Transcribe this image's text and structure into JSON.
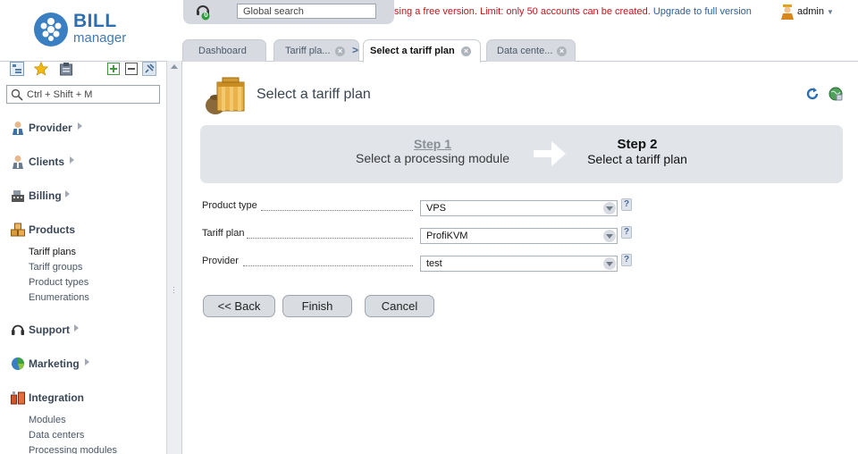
{
  "logo": {
    "word1": "BILL",
    "word2": "manager"
  },
  "topbar": {
    "notification_count": "0",
    "search_placeholder": "Global search"
  },
  "banner": {
    "warning": "sing a free version. Limit: only 50 accounts can be created.",
    "upgrade_link": "Upgrade to full version"
  },
  "user": {
    "name": "admin"
  },
  "tabs": [
    {
      "label": "Dashboard"
    },
    {
      "label": "Tariff pla..."
    },
    {
      "label": "Select a tariff plan"
    },
    {
      "label": "Data cente..."
    }
  ],
  "tab_separator": ">",
  "sidebar": {
    "search_placeholder": "Ctrl + Shift + M",
    "sections": [
      {
        "label": "Provider",
        "items": []
      },
      {
        "label": "Clients",
        "items": []
      },
      {
        "label": "Billing",
        "items": []
      },
      {
        "label": "Products",
        "items": [
          "Tariff plans",
          "Tariff groups",
          "Product types",
          "Enumerations"
        ]
      },
      {
        "label": "Support",
        "items": []
      },
      {
        "label": "Marketing",
        "items": []
      },
      {
        "label": "Integration",
        "items": [
          "Modules",
          "Data centers",
          "Processing modules"
        ]
      }
    ]
  },
  "main": {
    "title": "Select a tariff plan",
    "wizard": {
      "step1": {
        "title": "Step 1",
        "desc": "Select a processing module"
      },
      "step2": {
        "title": "Step 2",
        "desc": "Select a tariff plan"
      }
    },
    "fields": [
      {
        "label": "Product type",
        "value": "VPS"
      },
      {
        "label": "Tariff plan",
        "value": "ProfiKVM"
      },
      {
        "label": "Provider",
        "value": "test"
      }
    ],
    "help_mark": "?",
    "buttons": {
      "back": "<< Back",
      "finish": "Finish",
      "cancel": "Cancel"
    }
  },
  "colors": {
    "accent": "#2f6fb1",
    "warning": "#c0161b",
    "link": "#2e5e98",
    "panel": "#e1e4e9"
  }
}
